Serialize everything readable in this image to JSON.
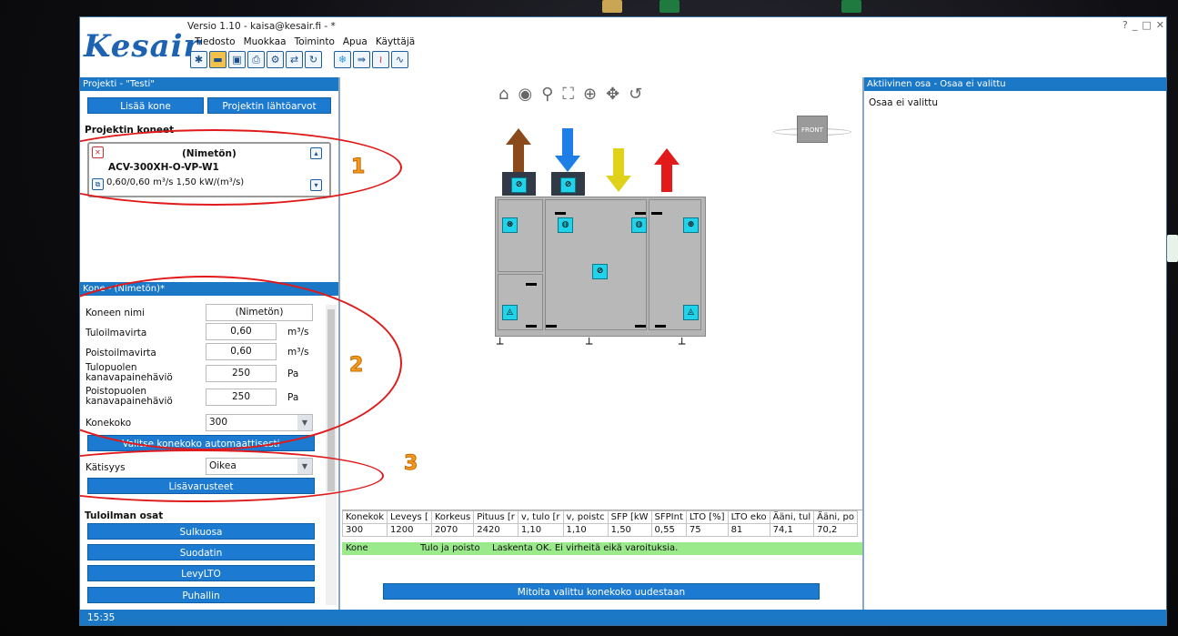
{
  "window": {
    "title": "Versio 1.10 - kaisa@kesair.fi - *",
    "logo": "Kesair",
    "controls": [
      "?",
      "_",
      "□",
      "✕"
    ]
  },
  "menu": [
    "Tiedosto",
    "Muokkaa",
    "Toiminto",
    "Apua",
    "Käyttäjä"
  ],
  "toolbar": {
    "icons": [
      "new-file-icon",
      "open-folder-icon",
      "save-icon",
      "print-icon",
      "settings-gear-icon",
      "swap-icon",
      "refresh-icon",
      "cooling-snowflake-icon",
      "unit-config-icon",
      "heating-icon",
      "sound-icon"
    ]
  },
  "project": {
    "header": "Projekti - \"Testi\"",
    "add_machine": "Lisää kone",
    "defaults": "Projektin lähtöarvot",
    "machines_label": "Projektin koneet",
    "card": {
      "name": "(Nimetön)",
      "model": "ACV-300XH-O-VP-W1",
      "specs": "0,60/0,60 m³/s   1,50 kW/(m³/s)"
    }
  },
  "machine": {
    "header": "Kone - (Nimetön)*",
    "fields": {
      "name_label": "Koneen nimi",
      "name_value": "(Nimetön)",
      "supply_label": "Tuloilmavirta",
      "supply_value": "0,60",
      "supply_unit": "m³/s",
      "exhaust_label": "Poistoilmavirta",
      "exhaust_value": "0,60",
      "exhaust_unit": "m³/s",
      "supply_pressure_label": "Tulopuolen kanavapainehäviö",
      "supply_pressure_value": "250",
      "supply_pressure_unit": "Pa",
      "exhaust_pressure_label": "Poistopuolen kanavapainehäviö",
      "exhaust_pressure_value": "250",
      "exhaust_pressure_unit": "Pa",
      "size_label": "Konekoko",
      "size_value": "300",
      "auto_size_button": "Valitse konekoko automaattisesti",
      "handedness_label": "Kätisyys",
      "handedness_value": "Oikea",
      "accessories_button": "Lisävarusteet"
    },
    "supply_parts_label": "Tuloilman osat",
    "supply_parts": [
      "Sulkuosa",
      "Suodatin",
      "LevyLTO",
      "Puhallin"
    ]
  },
  "results": {
    "columns": [
      "Konekok",
      "Leveys [",
      "Korkeus",
      "Pituus [r",
      "v, tulo [r",
      "v, poistc",
      "SFP [kW",
      "SFPInt",
      "LTO [%]",
      "LTO eko",
      "Ääni, tul",
      "Ääni, po"
    ],
    "row": [
      "300",
      "1200",
      "2070",
      "2420",
      "1,10",
      "1,10",
      "1,50",
      "0,55",
      "75",
      "81",
      "74,1",
      "70,2"
    ],
    "status_col1": "Kone",
    "status_col2": "Tulo ja poisto",
    "status_message": "Laskenta OK. Ei virheitä eikä varoituksia.",
    "resize_button": "Mitoita valittu konekoko uudestaan"
  },
  "active_part": {
    "header": "Aktiivinen osa - Osaa ei valittu",
    "text": "Osaa ei valittu"
  },
  "view": {
    "front_label": "FRONT"
  },
  "statusbar": {
    "time": "15:35"
  },
  "annotations": [
    "1",
    "2",
    "3"
  ],
  "colors": {
    "accent": "#1b78c6",
    "annotation": "#e01a1a",
    "annotation_number": "#f59a20",
    "status_ok": "#9aea8c",
    "component": "#20d3ea"
  }
}
